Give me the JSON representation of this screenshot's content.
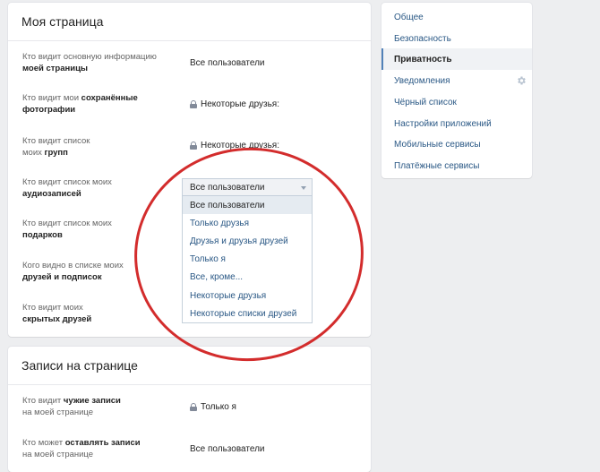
{
  "privacy_card": {
    "title": "Моя страница",
    "rows": [
      {
        "label_plain": "Кто видит основную информацию ",
        "label_bold": "моей страницы",
        "value": "Все пользователи",
        "locked": false
      },
      {
        "label_plain": "Кто видит мои ",
        "label_bold": "сохранённые фотографии",
        "value": "Некоторые друзья:",
        "locked": true
      },
      {
        "label_plain": "Кто видит список моих ",
        "label_bold": "групп",
        "value": "Некоторые друзья:",
        "locked": true
      },
      {
        "label_plain": "Кто видит список моих ",
        "label_bold": "аудиозаписей",
        "value": "",
        "locked": false
      },
      {
        "label_plain": "Кто видит список моих ",
        "label_bold": "подарков",
        "value": "",
        "locked": false
      },
      {
        "label_plain": "Кого видно в списке моих ",
        "label_bold": "друзей и подписок",
        "value": "",
        "locked": false
      },
      {
        "label_plain": "Кто видит моих ",
        "label_bold": "скрытых друзей",
        "value": "",
        "locked": false
      }
    ]
  },
  "audio_select": {
    "selected": "Все пользователи",
    "options": [
      "Все пользователи",
      "Только друзья",
      "Друзья и друзья друзей",
      "Только я",
      "Все, кроме...",
      "Некоторые друзья",
      "Некоторые списки друзей"
    ]
  },
  "posts_card": {
    "title": "Записи на странице",
    "rows": [
      {
        "label_plain": "Кто видит ",
        "label_bold": "чужие записи",
        "label_after": " на моей странице",
        "value": "Только я",
        "locked": true
      },
      {
        "label_plain": "Кто может ",
        "label_bold": "оставлять записи",
        "label_after": " на моей странице",
        "value": "Все пользователи",
        "locked": false
      }
    ]
  },
  "settings_menu": {
    "items": [
      "Общее",
      "Безопасность",
      "Приватность",
      "Уведомления",
      "Чёрный список",
      "Настройки приложений",
      "Мобильные сервисы",
      "Платёжные сервисы"
    ],
    "active": "Приватность"
  },
  "colors": {
    "accent": "#5181b8",
    "link": "#2a5885",
    "annotation_circle": "#d32c2c"
  },
  "icons": {
    "lock": "lock-icon",
    "notifications_settings": "gear-icon",
    "dropdown": "chevron-down-icon"
  }
}
